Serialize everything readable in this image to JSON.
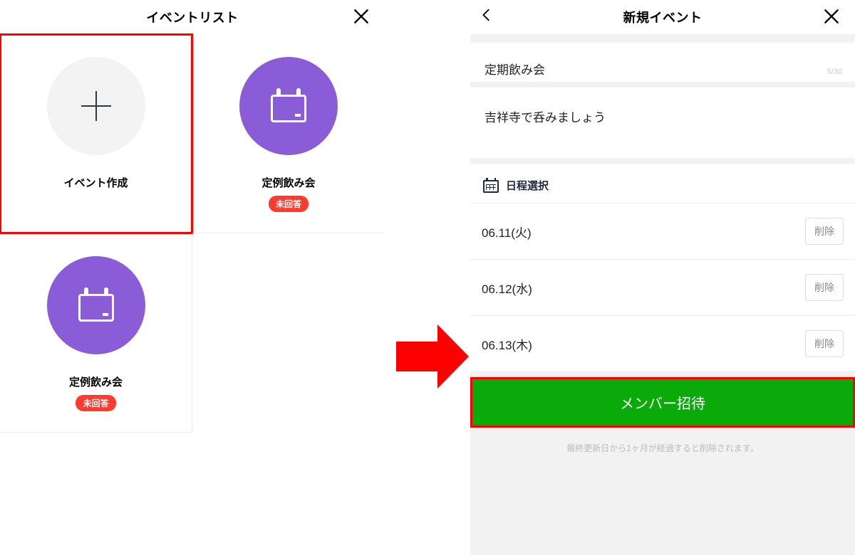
{
  "left": {
    "header": {
      "title": "イベントリスト"
    },
    "tiles": [
      {
        "label": "イベント作成",
        "kind": "create"
      },
      {
        "label": "定例飲み会",
        "kind": "event",
        "badge": "未回答"
      },
      {
        "label": "定例飲み会",
        "kind": "event",
        "badge": "未回答"
      }
    ]
  },
  "right": {
    "header": {
      "title": "新規イベント"
    },
    "form": {
      "title_value": "定期飲み会",
      "title_counter": "5/30",
      "desc_value": "吉祥寺で呑みましょう"
    },
    "dates": {
      "label": "日程選択",
      "rows": [
        {
          "text": "06.11(火)",
          "del": "削除"
        },
        {
          "text": "06.12(水)",
          "del": "削除"
        },
        {
          "text": "06.13(木)",
          "del": "削除"
        }
      ]
    },
    "invite_label": "メンバー招待",
    "footnote": "最終更新日から1ヶ月が経過すると削除されます。"
  },
  "colors": {
    "accent_purple": "#8a5cd8",
    "badge_red": "#ff3b30",
    "invite_green": "#0aaa0a"
  }
}
